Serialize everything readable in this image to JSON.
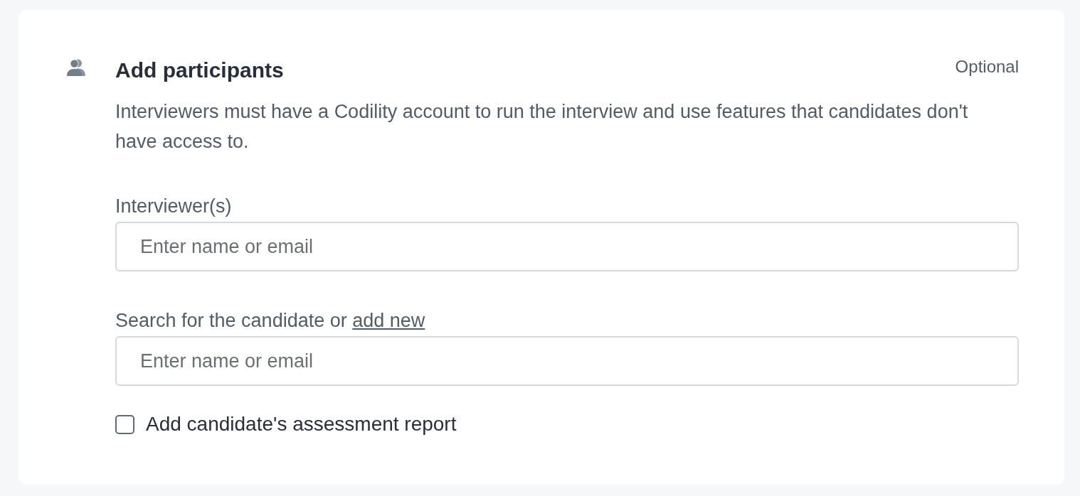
{
  "section": {
    "title": "Add participants",
    "badge": "Optional",
    "description": "Interviewers must have a Codility account to run the interview and use features that candidates don't have access to."
  },
  "fields": [
    {
      "label": "Interviewer(s)",
      "placeholder": "Enter name or email"
    },
    {
      "label": "Search for the candidate or",
      "link": "add new",
      "placeholder": "Enter name or email"
    }
  ],
  "checkbox": {
    "label": "Add candidate's assessment report",
    "checked": false
  }
}
